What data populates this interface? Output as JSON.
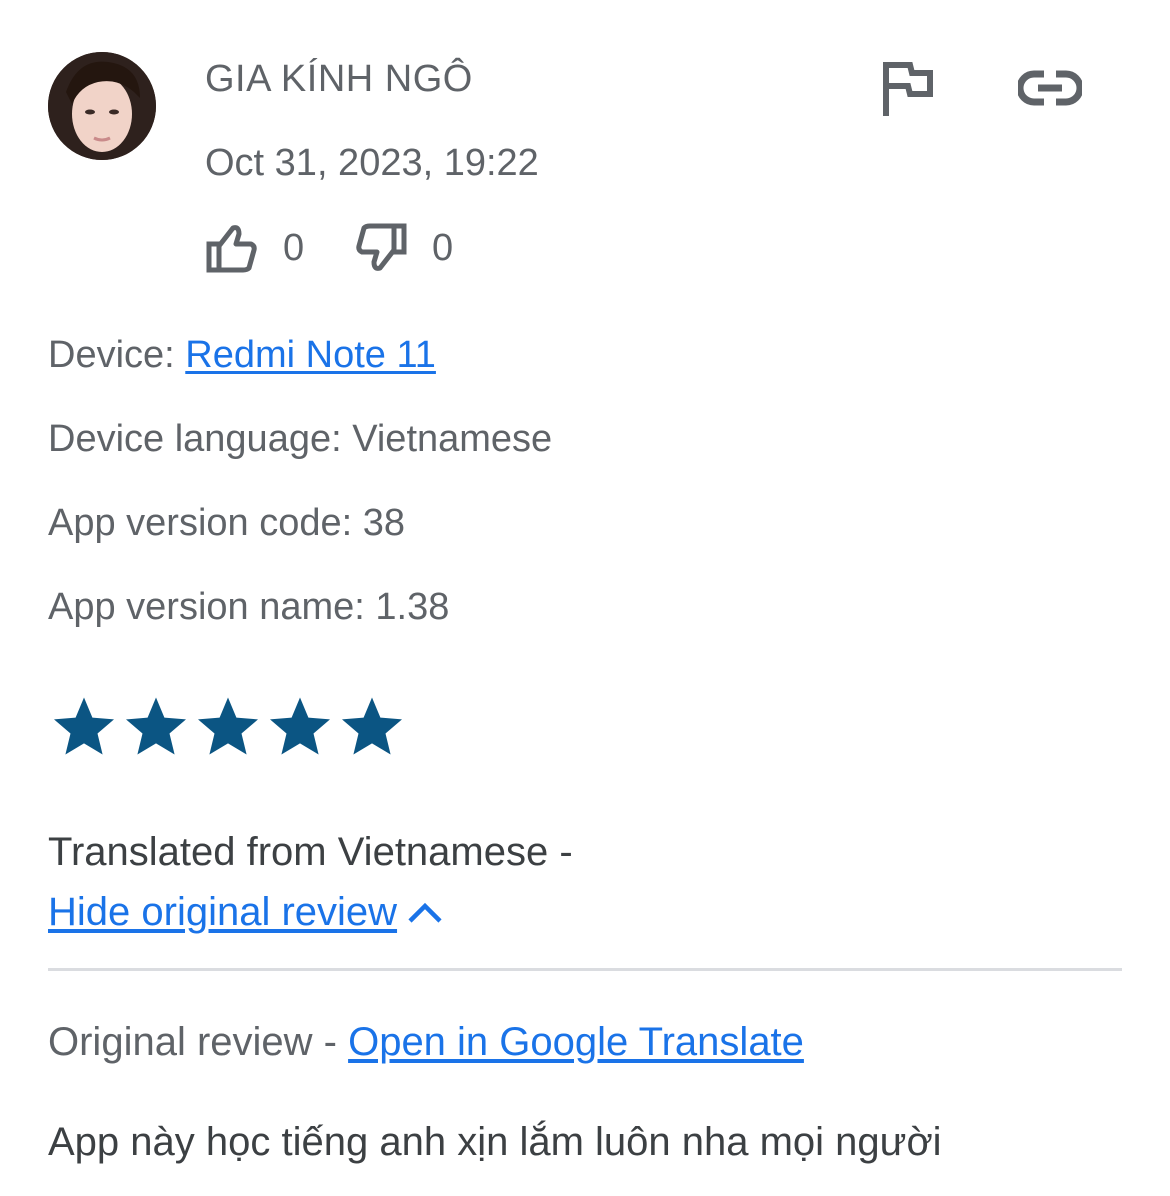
{
  "reviewer": {
    "name": "GIA KÍNH NGÔ",
    "date": "Oct 31, 2023, 19:22"
  },
  "votes": {
    "helpful_count": "0",
    "unhelpful_count": "0"
  },
  "icons": {
    "flag": "flag-icon",
    "link": "link-icon",
    "thumbs_up": "thumbs-up-icon",
    "thumbs_down": "thumbs-down-icon",
    "chevron": "chevron-up-icon"
  },
  "device": {
    "device_label": "Device: ",
    "device_value": "Redmi Note 11",
    "language": "Device language: Vietnamese",
    "version_code": "App version code: 38",
    "version_name": "App version name: 1.38"
  },
  "rating": {
    "stars": 5,
    "max": 5,
    "color": "#0b5583"
  },
  "translation": {
    "note": "Translated from Vietnamese -",
    "hide_link": "Hide original review"
  },
  "original": {
    "label": "Original review - ",
    "translate_link": "Open in Google Translate",
    "text": "App này học tiếng anh xịn lắm luôn nha mọi người"
  },
  "colors": {
    "link": "#1a73e8",
    "text": "#5f6368",
    "star": "#0b5583"
  }
}
